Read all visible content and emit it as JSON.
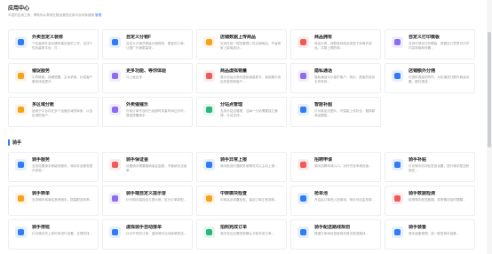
{
  "header": {
    "title": "应用中心",
    "subtitle": "丰富的应用工具，帮助你从零到无数运营的应用平台玩转营销",
    "link": "管理"
  },
  "section_b": {
    "title": "骑手"
  },
  "cards_a": [
    {
      "name": "外卖自定义装修",
      "desc": "个性装修外卖店铺风格页面的工作，支持个性化装修平台，打...",
      "icon": "shop-icon",
      "color": "#2f7df6"
    },
    {
      "name": "自定义分销F",
      "desc": "自定义分销员等级分佣规则，更高的订单，让推广分销更高效...",
      "icon": "share-icon",
      "color": "#2f7df6"
    },
    {
      "name": "店铺数据上传商品",
      "desc": "支持在统一规范管理人员店铺商品，节省商家上架商品功...",
      "icon": "upload-icon",
      "color": "#f7a21b"
    },
    {
      "name": "商品拥有",
      "desc": "商品分类，按照各种商品类型下拿离开成品，字数上限的商...",
      "icon": "goods-icon",
      "color": "#ef5a5a"
    },
    {
      "name": "自定义打印模板",
      "desc": "支持可视化打印模板，根据自己意思对打印内容排版和设置...",
      "icon": "print-icon",
      "color": "#8c6cf0"
    },
    {
      "name": "催促服务",
      "desc": "引导顾客，按键提醒，主动求助，补偿客户服务体验提升...",
      "icon": "remind-icon",
      "color": "#f7a21b"
    },
    {
      "name": "更多功能、等你体验",
      "desc": "马上就出来...",
      "icon": "more-icon",
      "color": "#8c6cf0"
    },
    {
      "name": "商品虚拟销量",
      "desc": "展示在给出来的虚拟销量数字，营销展示真实的感觉和客户...",
      "icon": "sales-icon",
      "color": "#ef5a5a"
    },
    {
      "name": "隐私通话",
      "desc": "隐私通话可以保护客户、骑手、顾客的真实手机号码...",
      "icon": "phone-icon",
      "color": "#8c6cf0"
    },
    {
      "name": "店铺额外分佣",
      "desc": "在提供佣金的同时，对店铺进行额外佣金设置，额外提成...",
      "icon": "commission-icon",
      "color": "#2f7df6"
    },
    {
      "name": "多区域分账",
      "desc": "适用于平台存在多个运营区域的商家，以及区域的商户...",
      "icon": "split-icon",
      "color": "#f7a21b"
    },
    {
      "name": "外卖催催乐",
      "desc": "外卖订单不及时已经超时或者时间过长时，督促提醒骑手...",
      "icon": "urge-icon",
      "color": "#8c6cf0"
    },
    {
      "name": "分站点管理",
      "desc": "支持分站点管理，当每一分站需要独立管理，分站支持...",
      "icon": "site-icon",
      "color": "#2cb67d"
    },
    {
      "name": "智能补图",
      "desc": "针对商品无图片，可智能上传补全，替换原商品模板...",
      "icon": "image-icon",
      "color": "#2f7df6"
    }
  ],
  "cards_b": [
    {
      "name": "骑手服务",
      "desc": "支持设置骑手等级的服务，骑手补全服务提升体验...",
      "icon": "rider-icon",
      "color": "#2f7df6"
    },
    {
      "name": "骑手保证金",
      "desc": "设置骑手需要缴纳保证金额，不缴纳无法接单...",
      "icon": "deposit-icon",
      "color": "#ef5a5a"
    },
    {
      "name": "骑手异常上报",
      "desc": "骑手配送时遇到异常情况可以主动上报...",
      "icon": "report-icon",
      "color": "#2f7df6"
    },
    {
      "name": "招聘申请",
      "desc": "骑手招聘申请入口，对外开放申请页面...",
      "icon": "recruit-icon",
      "color": "#ef5a5a"
    },
    {
      "name": "骑手补贴",
      "desc": "针对骑手的补贴发放设置，提升骑手配送积极性...",
      "icon": "subsidy-icon",
      "color": "#2f7df6"
    },
    {
      "name": "骑手转单",
      "desc": "支持骑手转单给其他骑手，提高配送效率...",
      "icon": "transfer-icon",
      "color": "#f7a21b"
    },
    {
      "name": "骑手端自定义提示音",
      "desc": "针对骑手端自定义提示音，区分订单类型...",
      "icon": "sound-icon",
      "color": "#8c6cf0"
    },
    {
      "name": "中转模块检查",
      "desc": "中转站点设置检查，保证订单正常流转...",
      "icon": "check-icon",
      "color": "#f7a21b"
    },
    {
      "name": "抢单池",
      "desc": "开启后订单进入抢单池，骑手可自由抢单...",
      "icon": "pool-icon",
      "color": "#2f7df6"
    },
    {
      "name": "骑手数据检测",
      "desc": "检测骑手配送数据，异常情况及时提醒...",
      "icon": "data-icon",
      "color": "#ef5a5a"
    },
    {
      "name": "骑手排班",
      "desc": "针对骑手的上班时间进行设置，合理安排...",
      "icon": "schedule-icon",
      "color": "#2f7df6"
    },
    {
      "name": "虚拟骑手自动接单",
      "desc": "针对不同的订单，虚拟骑手自动接单配送...",
      "icon": "auto-icon",
      "color": "#2f7df6"
    },
    {
      "name": "拍照完成订单",
      "desc": "骑手送达后需拍照确认才能完成订单...",
      "icon": "camera-icon",
      "color": "#2cb67d"
    },
    {
      "name": "骑手配送路线规划",
      "desc": "根据订单地址智能规划骑手配送路线...",
      "icon": "route-icon",
      "color": "#2f7df6"
    },
    {
      "name": "骑手装备",
      "desc": "骑手装备管理，统一配发骑手装备...",
      "icon": "equip-icon",
      "color": "#2f7df6"
    }
  ]
}
